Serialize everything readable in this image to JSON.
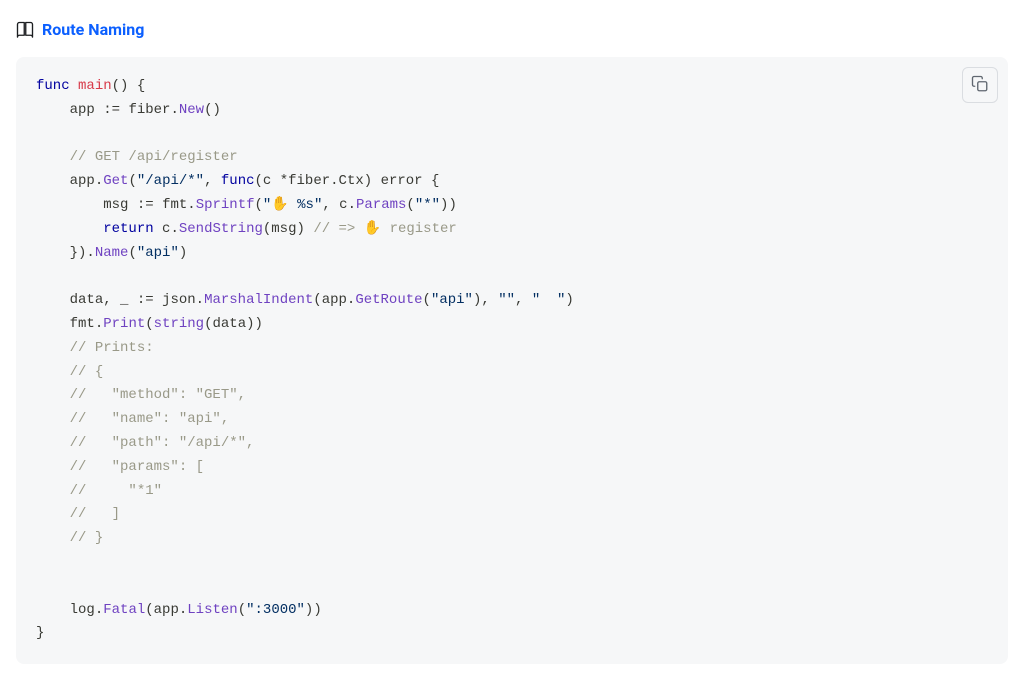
{
  "heading": {
    "icon": "book-icon",
    "link_text": "Route Naming",
    "href": "#"
  },
  "copy": {
    "label": "Copy"
  },
  "code": {
    "l1": {
      "func": "func",
      "main": "main",
      "p1": "(",
      "p2": ")",
      "b": "{"
    },
    "l2": {
      "app": "app",
      "assign": ":=",
      "fiber": "fiber",
      "dot": ".",
      "new": "New",
      "p1": "(",
      "p2": ")"
    },
    "l4": {
      "cmt": "// GET /api/register"
    },
    "l5": {
      "app": "app",
      "dot1": ".",
      "get": "Get",
      "p1": "(",
      "s": "\"/api/*\"",
      "comma": ",",
      "func": "func",
      "p2": "(",
      "c": "c",
      "star": "*",
      "fiber": "fiber",
      "dot2": ".",
      "ctx": "Ctx",
      "p3": ")",
      "err": "error",
      "b": "{"
    },
    "l6": {
      "msg": "msg",
      "assign": ":=",
      "fmt": "fmt",
      "dot": ".",
      "sprintf": "Sprintf",
      "p1": "(",
      "s1a": "\"",
      "emj": "✋",
      "s1b": " %s\"",
      "comma": ",",
      "c": "c",
      "dot2": ".",
      "params": "Params",
      "p2": "(",
      "s2": "\"*\"",
      "p3": ")",
      "p4": ")"
    },
    "l7": {
      "ret": "return",
      "c": "c",
      "dot": ".",
      "send": "SendString",
      "p1": "(",
      "msg": "msg",
      "p2": ")",
      "cmt1": "// => ",
      "emj": "✋",
      "cmt2": " register"
    },
    "l8": {
      "b": "}",
      "p1": ")",
      "dot": ".",
      "name": "Name",
      "p2": "(",
      "s": "\"api\"",
      "p3": ")"
    },
    "l10": {
      "data": "data",
      "comma": ",",
      "us": "_",
      "assign": ":=",
      "json": "json",
      "dot": ".",
      "mi": "MarshalIndent",
      "p1": "(",
      "app": "app",
      "dot2": ".",
      "gr": "GetRoute",
      "p2": "(",
      "s1": "\"api\"",
      "p3": ")",
      "comma2": ",",
      "s2": "\"\"",
      "comma3": ",",
      "s3": "\"  \"",
      "p4": ")"
    },
    "l11": {
      "fmt": "fmt",
      "dot": ".",
      "print": "Print",
      "p1": "(",
      "string": "string",
      "p2": "(",
      "data": "data",
      "p3": ")",
      "p4": ")"
    },
    "l12": {
      "cmt": "// Prints:"
    },
    "l13": {
      "cmt": "// {"
    },
    "l14": {
      "cmt": "//   \"method\": \"GET\","
    },
    "l15": {
      "cmt": "//   \"name\": \"api\","
    },
    "l16": {
      "cmt": "//   \"path\": \"/api/*\","
    },
    "l17": {
      "cmt": "//   \"params\": ["
    },
    "l18": {
      "cmt": "//     \"*1\""
    },
    "l19": {
      "cmt": "//   ]"
    },
    "l20": {
      "cmt": "// }"
    },
    "l23": {
      "log": "log",
      "dot": ".",
      "fatal": "Fatal",
      "p1": "(",
      "app": "app",
      "dot2": ".",
      "listen": "Listen",
      "p2": "(",
      "s": "\":3000\"",
      "p3": ")",
      "p4": ")"
    },
    "l24": {
      "b": "}"
    }
  }
}
